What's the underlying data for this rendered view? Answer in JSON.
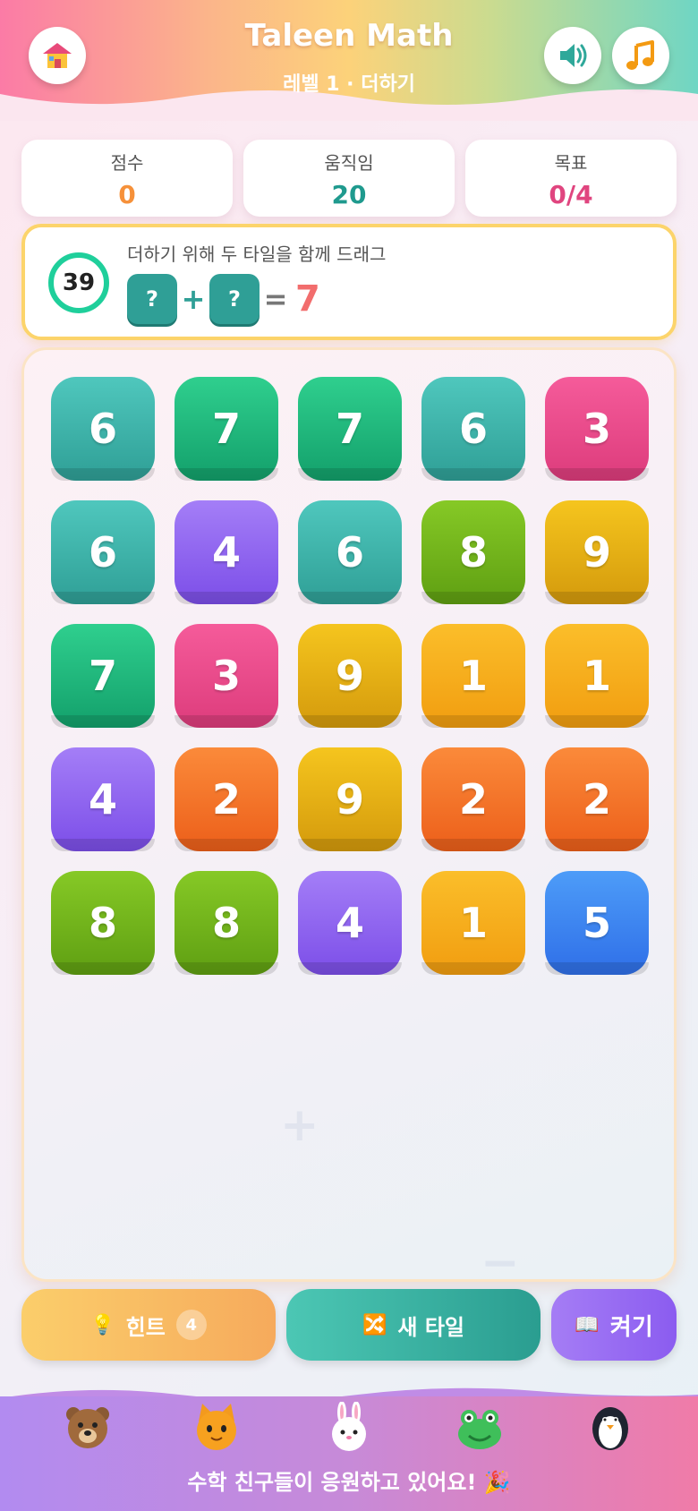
{
  "header": {
    "title": "Taleen Math",
    "subtitle": "레벨 1 · 더하기",
    "home_icon": "house-icon",
    "sound_icon": "speaker-icon",
    "music_icon": "music-note-icon"
  },
  "stats": {
    "score_label": "점수",
    "score_value": "0",
    "moves_label": "움직임",
    "moves_value": "20",
    "goal_label": "목표",
    "goal_value": "0/4"
  },
  "target": {
    "timer": "39",
    "instruction": "더하기 위해 두 타일을 함께 드래그",
    "slot_a": "?",
    "operator": "+",
    "slot_b": "?",
    "equals": "=",
    "target_value": "7"
  },
  "board": {
    "tiles": [
      {
        "value": "6",
        "color": "teal"
      },
      {
        "value": "7",
        "color": "green"
      },
      {
        "value": "7",
        "color": "green"
      },
      {
        "value": "6",
        "color": "teal"
      },
      {
        "value": "3",
        "color": "pink"
      },
      {
        "value": "6",
        "color": "teal"
      },
      {
        "value": "4",
        "color": "purple"
      },
      {
        "value": "6",
        "color": "teal"
      },
      {
        "value": "8",
        "color": "lime"
      },
      {
        "value": "9",
        "color": "gold"
      },
      {
        "value": "7",
        "color": "green"
      },
      {
        "value": "3",
        "color": "pink"
      },
      {
        "value": "9",
        "color": "gold"
      },
      {
        "value": "1",
        "color": "amber"
      },
      {
        "value": "1",
        "color": "amber"
      },
      {
        "value": "4",
        "color": "purple"
      },
      {
        "value": "2",
        "color": "orange"
      },
      {
        "value": "9",
        "color": "gold"
      },
      {
        "value": "2",
        "color": "orange"
      },
      {
        "value": "2",
        "color": "orange"
      },
      {
        "value": "8",
        "color": "lime"
      },
      {
        "value": "8",
        "color": "lime"
      },
      {
        "value": "4",
        "color": "purple"
      },
      {
        "value": "1",
        "color": "amber"
      },
      {
        "value": "5",
        "color": "blue"
      }
    ]
  },
  "tile_colors": {
    "teal": [
      "#4fc7bd",
      "#2f9f96"
    ],
    "green": [
      "#2fcf8e",
      "#13a06b"
    ],
    "pink": [
      "#f55b9a",
      "#dd3c7c"
    ],
    "purple": [
      "#a47ef7",
      "#7c4ee8"
    ],
    "lime": [
      "#86c926",
      "#5f9f12"
    ],
    "gold": [
      "#f5c51e",
      "#d49a0c"
    ],
    "amber": [
      "#fbbe2a",
      "#f19d10"
    ],
    "orange": [
      "#fb8a3a",
      "#ec5f1a"
    ],
    "blue": [
      "#4d9cf8",
      "#2f6fe8"
    ]
  },
  "actions": {
    "hint_label": "힌트",
    "hint_count": "4",
    "hint_icon": "lightbulb-icon",
    "new_tiles_label": "새 타일",
    "new_tiles_icon": "shuffle-icon",
    "toggle_label": "켜기",
    "toggle_icon": "book-icon"
  },
  "footer": {
    "animals": [
      "bear-icon",
      "cat-icon",
      "bunny-icon",
      "frog-icon",
      "penguin-icon"
    ],
    "cheer_text": "수학 친구들이 응원하고 있어요! 🎉"
  }
}
